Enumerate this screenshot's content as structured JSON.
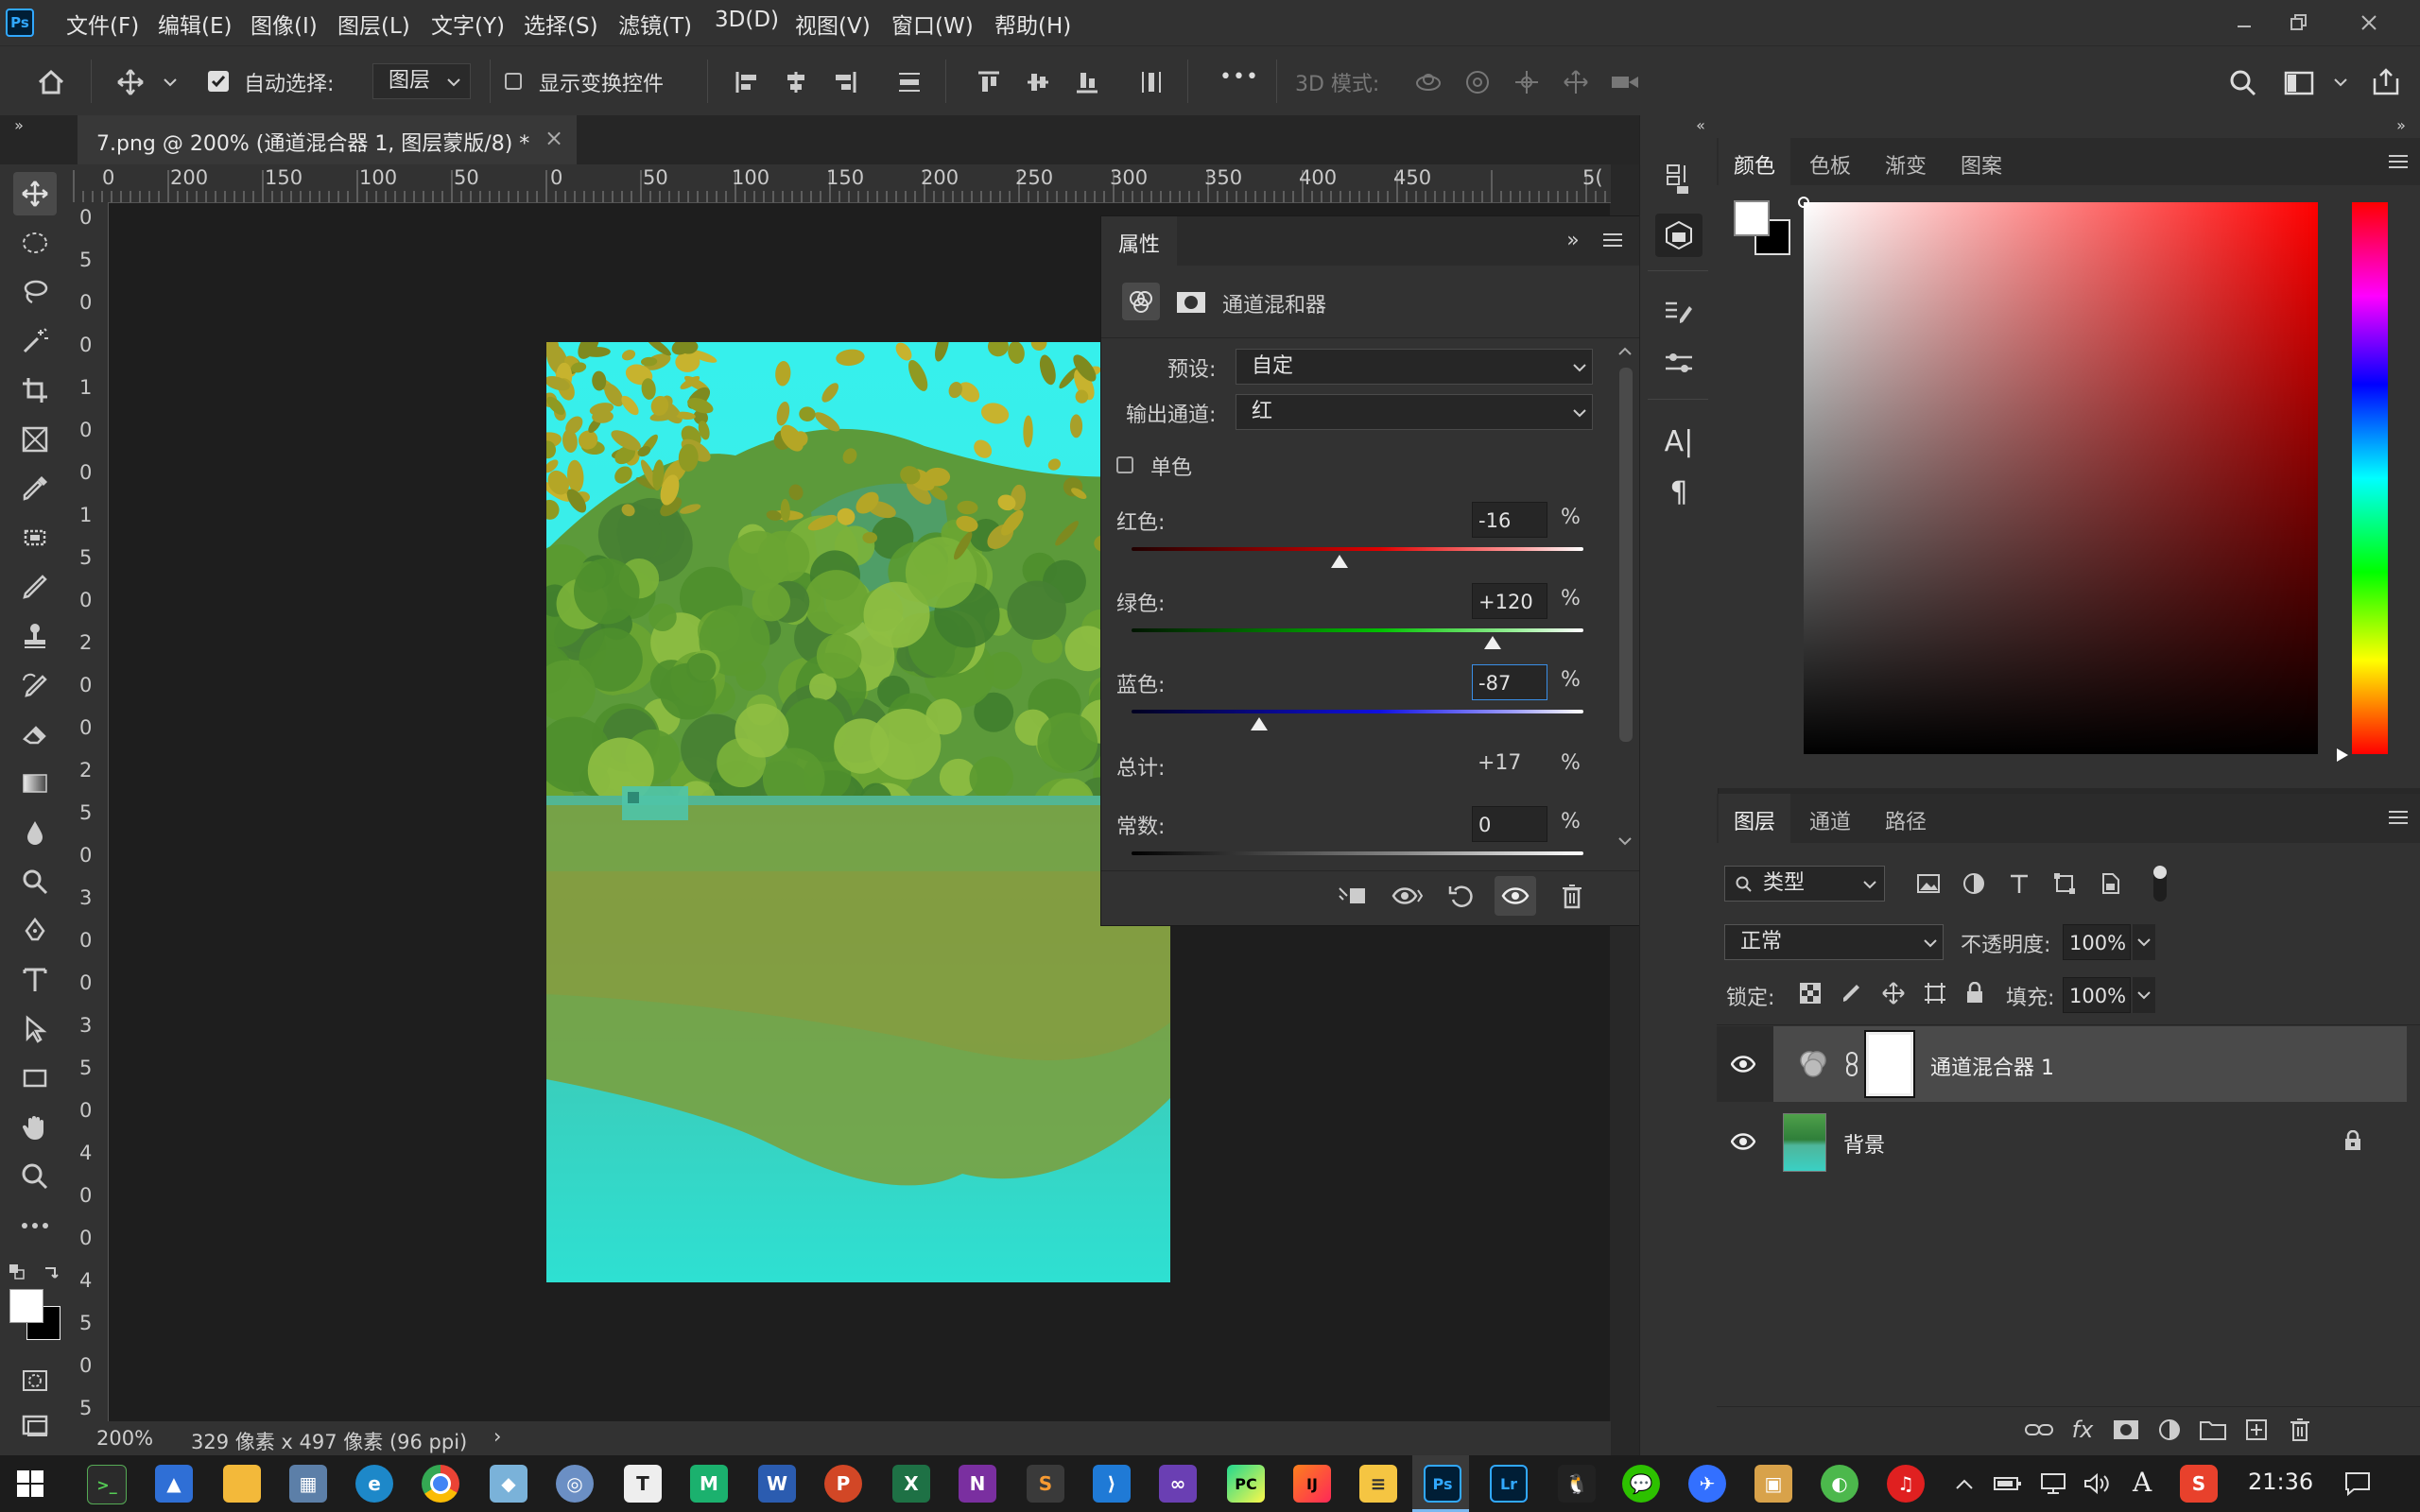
{
  "app": {
    "logo": "Ps",
    "accent": "#31a8ff"
  },
  "menu": [
    "文件(F)",
    "编辑(E)",
    "图像(I)",
    "图层(L)",
    "文字(Y)",
    "选择(S)",
    "滤镜(T)",
    "3D(D)",
    "视图(V)",
    "窗口(W)",
    "帮助(H)"
  ],
  "options": {
    "auto_select_label": "自动选择:",
    "auto_select_target": "图层",
    "show_transform_label": "显示变换控件",
    "mode_3d_label": "3D 模式:",
    "more": "•••"
  },
  "document": {
    "tab_title": "7.png @ 200% (通道混合器 1, 图层蒙版/8) *",
    "close": "×",
    "zoom": "200%",
    "info": "329 像素 x 497 像素 (96 ppi)",
    "info_arrow": "›"
  },
  "ruler": {
    "h_ticks": [
      "0",
      "200",
      "150",
      "100",
      "50",
      "0",
      "50",
      "100",
      "150",
      "200",
      "250",
      "300",
      "350",
      "400",
      "450",
      "5("
    ],
    "v_ticks": [
      "0",
      "5",
      "0",
      "0",
      "1",
      "0",
      "0",
      "1",
      "5",
      "0",
      "2",
      "0",
      "0",
      "2",
      "5",
      "0",
      "3",
      "0",
      "0",
      "3",
      "5",
      "0",
      "4",
      "0",
      "0",
      "4",
      "5",
      "0",
      "5"
    ]
  },
  "properties": {
    "title": "属性",
    "subtitle": "通道混和器",
    "preset_label": "预设:",
    "preset_value": "自定",
    "output_label": "输出通道:",
    "output_value": "红",
    "mono_label": "单色",
    "red_label": "红色:",
    "red_value": "-16",
    "green_label": "绿色:",
    "green_value": "+120",
    "blue_label": "蓝色:",
    "blue_value": "-87",
    "total_label": "总计:",
    "total_value": "+17",
    "constant_label": "常数:",
    "constant_value": "0",
    "percent": "%",
    "slider_levels": {
      "red": -16,
      "green": 120,
      "blue": -87,
      "constant": 0,
      "range": [
        -200,
        200
      ]
    }
  },
  "color_panel": {
    "tabs": [
      "颜色",
      "色板",
      "渐变",
      "图案"
    ],
    "foreground": "#ffffff",
    "background": "#000000",
    "picker_hue": "#ff0000"
  },
  "layers_panel": {
    "tabs": [
      "图层",
      "通道",
      "路径"
    ],
    "filter_label": "类型",
    "blend_mode": "正常",
    "opacity_label": "不透明度:",
    "opacity_value": "100%",
    "lock_label": "锁定:",
    "fill_label": "填充:",
    "fill_value": "100%",
    "layers": [
      {
        "name": "通道混合器 1",
        "selected": true
      },
      {
        "name": "背景",
        "locked": true
      }
    ]
  },
  "taskbar": {
    "time": "21:36",
    "ime": "A",
    "apps": [
      "terminal",
      "pc-manager",
      "file-explorer",
      "calculator",
      "edge",
      "chrome",
      "notes",
      "browser",
      "typora",
      "mindmaster",
      "word",
      "powerpoint",
      "excel",
      "onenote",
      "sublime",
      "vscode",
      "visual-studio",
      "pycharm",
      "intellij",
      "notepad",
      "photoshop",
      "lightroom",
      "qq",
      "wechat",
      "feishu",
      "store",
      "360",
      "netease-music"
    ]
  }
}
